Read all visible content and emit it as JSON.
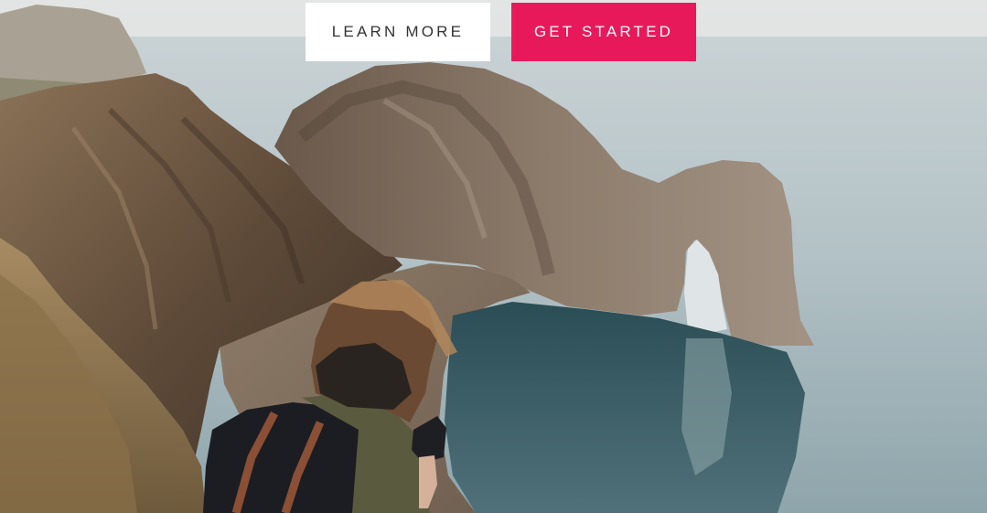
{
  "hero": {
    "image_alt": "Coastal cliffs with a natural rock arch over the sea and a hiker with a backpack in the foreground",
    "buttons": {
      "learn_more": "LEARN MORE",
      "get_started": "GET STARTED"
    }
  },
  "colors": {
    "primary_accent": "#e8195a",
    "secondary_button_bg": "#ffffff",
    "secondary_button_text": "#333333"
  }
}
